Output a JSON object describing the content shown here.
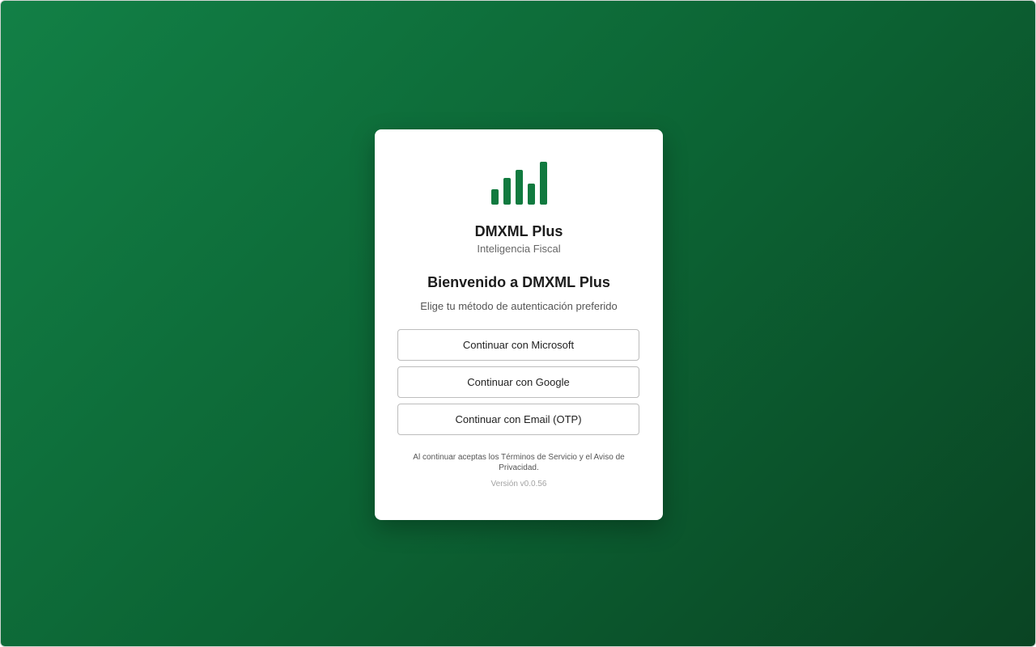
{
  "branding": {
    "app_name": "DMXML Plus",
    "tagline": "Inteligencia Fiscal",
    "logo_icon": "bar-chart-icon",
    "brand_color": "#117a3f",
    "background_gradient": [
      "#128046",
      "#0a4423"
    ]
  },
  "login": {
    "title": "Bienvenido a DMXML Plus",
    "subtitle": "Elige tu método de autenticación preferido",
    "buttons": {
      "microsoft": "Continuar con Microsoft",
      "google": "Continuar con Google",
      "email": "Continuar con Email (OTP)"
    },
    "legal_text": "Al continuar aceptas los Términos de Servicio y el Aviso de Privacidad.",
    "version": "Versión v0.0.56"
  }
}
